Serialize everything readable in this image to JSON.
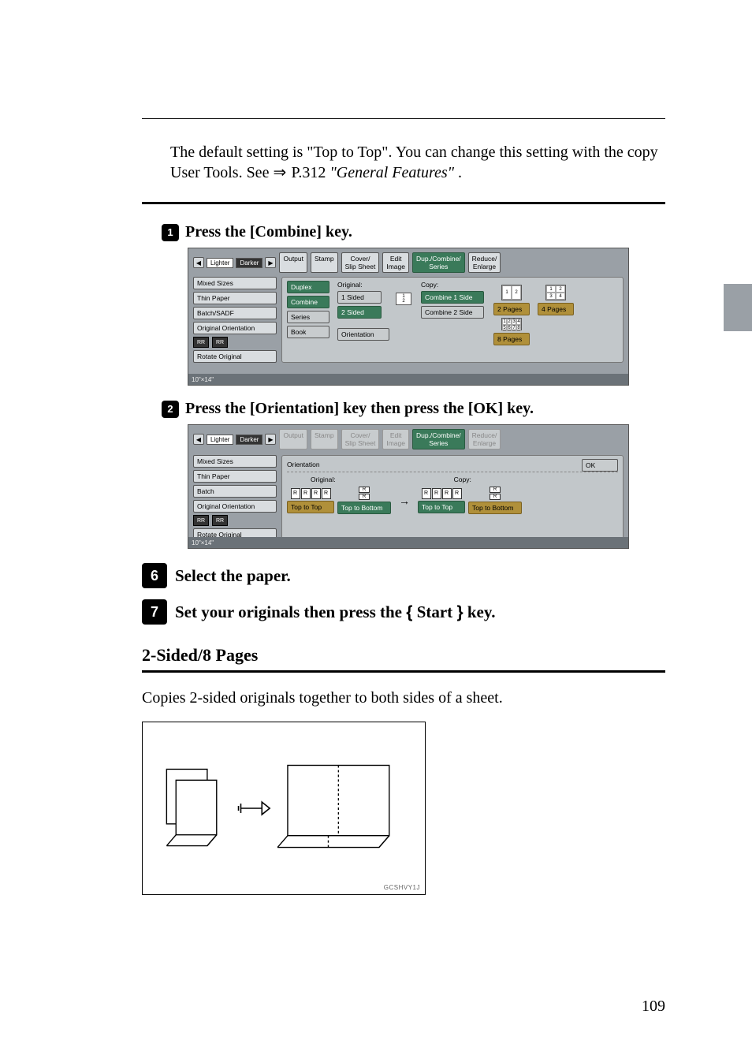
{
  "intro_paragraph_part1": "The default setting is \"Top to Top\". You can change this setting with the copy User Tools. See ",
  "intro_ref": "P.312 ",
  "intro_ref_title": "\"General Features\"",
  "intro_ref_end": ".",
  "step_a": {
    "num": "1",
    "prefix": "Press the ",
    "mid_key": "[Combine]",
    "suffix": " key."
  },
  "step_b": {
    "num": "2",
    "prefix": "Press the ",
    "key1": "[Orientation]",
    "mid": " key then press the ",
    "key2": "[OK]",
    "suffix": " key."
  },
  "big_step_6": {
    "num": "6",
    "text": "Select the paper."
  },
  "big_step_7": {
    "num": "7",
    "prefix": "Set your originals then press the ",
    "key_open": "{",
    "key_name": "Start",
    "key_close": "}",
    "suffix": " key."
  },
  "section_title": "2-Sided/8 Pages",
  "section_desc": "Copies 2-sided originals together to both sides of a sheet.",
  "diagram_code": "GCSHVY1J",
  "page_number": "109",
  "ss1": {
    "toolbar": {
      "lighter": "Lighter",
      "darker": "Darker",
      "output": "Output",
      "stamp": "Stamp",
      "cover_slip": "Cover/\nSlip Sheet",
      "edit_image": "Edit\nImage",
      "dup_combine_series": "Dup./Combine/\nSeries",
      "reduce_enlarge": "Reduce/\nEnlarge"
    },
    "side": {
      "mixed_sizes": "Mixed Sizes",
      "thin_paper": "Thin Paper",
      "batch_sadf": "Batch/SADF",
      "original_orientation": "Original Orientation",
      "rotate_original": "Rotate Original"
    },
    "orient_r": "R",
    "main": {
      "duplex": "Duplex",
      "combine": "Combine",
      "series": "Series",
      "book": "Book",
      "original_label": "Original:",
      "one_sided": "1 Sided",
      "two_sided": "2 Sided",
      "orientation_btn": "Orientation",
      "copy_label": "Copy:",
      "combine_1side": "Combine 1 Side",
      "combine_2side": "Combine 2 Side",
      "two_pages": "2 Pages",
      "four_pages": "4 Pages",
      "eight_pages": "8 Pages"
    },
    "footer": "10\"×14\""
  },
  "ss2": {
    "toolbar": {
      "lighter": "Lighter",
      "darker": "Darker",
      "output": "Output",
      "stamp": "Stamp",
      "cover_slip": "Cover/\nSlip Sheet",
      "edit_image": "Edit\nImage",
      "dup_combine_series": "Dup./Combine/\nSeries",
      "reduce_enlarge": "Reduce/\nEnlarge"
    },
    "side": {
      "mixed_sizes": "Mixed Sizes",
      "thin_paper": "Thin Paper",
      "batch": "Batch",
      "original_orientation": "Original Orientation",
      "rotate_original": "Rotate Original"
    },
    "orient_r": "R",
    "main": {
      "orientation_label": "Orientation",
      "ok": "OK",
      "original_label": "Original:",
      "copy_label": "Copy:",
      "top_to_top": "Top to Top",
      "top_to_bottom": "Top to Bottom",
      "r": "R"
    },
    "footer": "10\"×14\""
  }
}
